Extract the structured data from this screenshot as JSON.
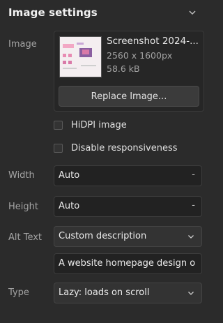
{
  "header": {
    "title": "Image settings",
    "collapse_icon": "chevron-down-icon"
  },
  "image": {
    "label": "Image",
    "file_name": "Screenshot 2024-...",
    "dimensions": "2560 x 1600px",
    "size": "58.6 kB",
    "replace_label": "Replace Image..."
  },
  "options": {
    "hidpi_label": "HiDPI image",
    "hidpi_checked": false,
    "disable_resp_label": "Disable responsiveness",
    "disable_resp_checked": false
  },
  "width": {
    "label": "Width",
    "value": "Auto",
    "unit": "-"
  },
  "height": {
    "label": "Height",
    "value": "Auto",
    "unit": "-"
  },
  "alt": {
    "label": "Alt Text",
    "mode": "Custom description",
    "text": "A website homepage design o"
  },
  "type": {
    "label": "Type",
    "value": "Lazy: loads on scroll"
  },
  "colors": {
    "background": "#2b2b2b",
    "field": "#222222",
    "select": "#333333"
  }
}
